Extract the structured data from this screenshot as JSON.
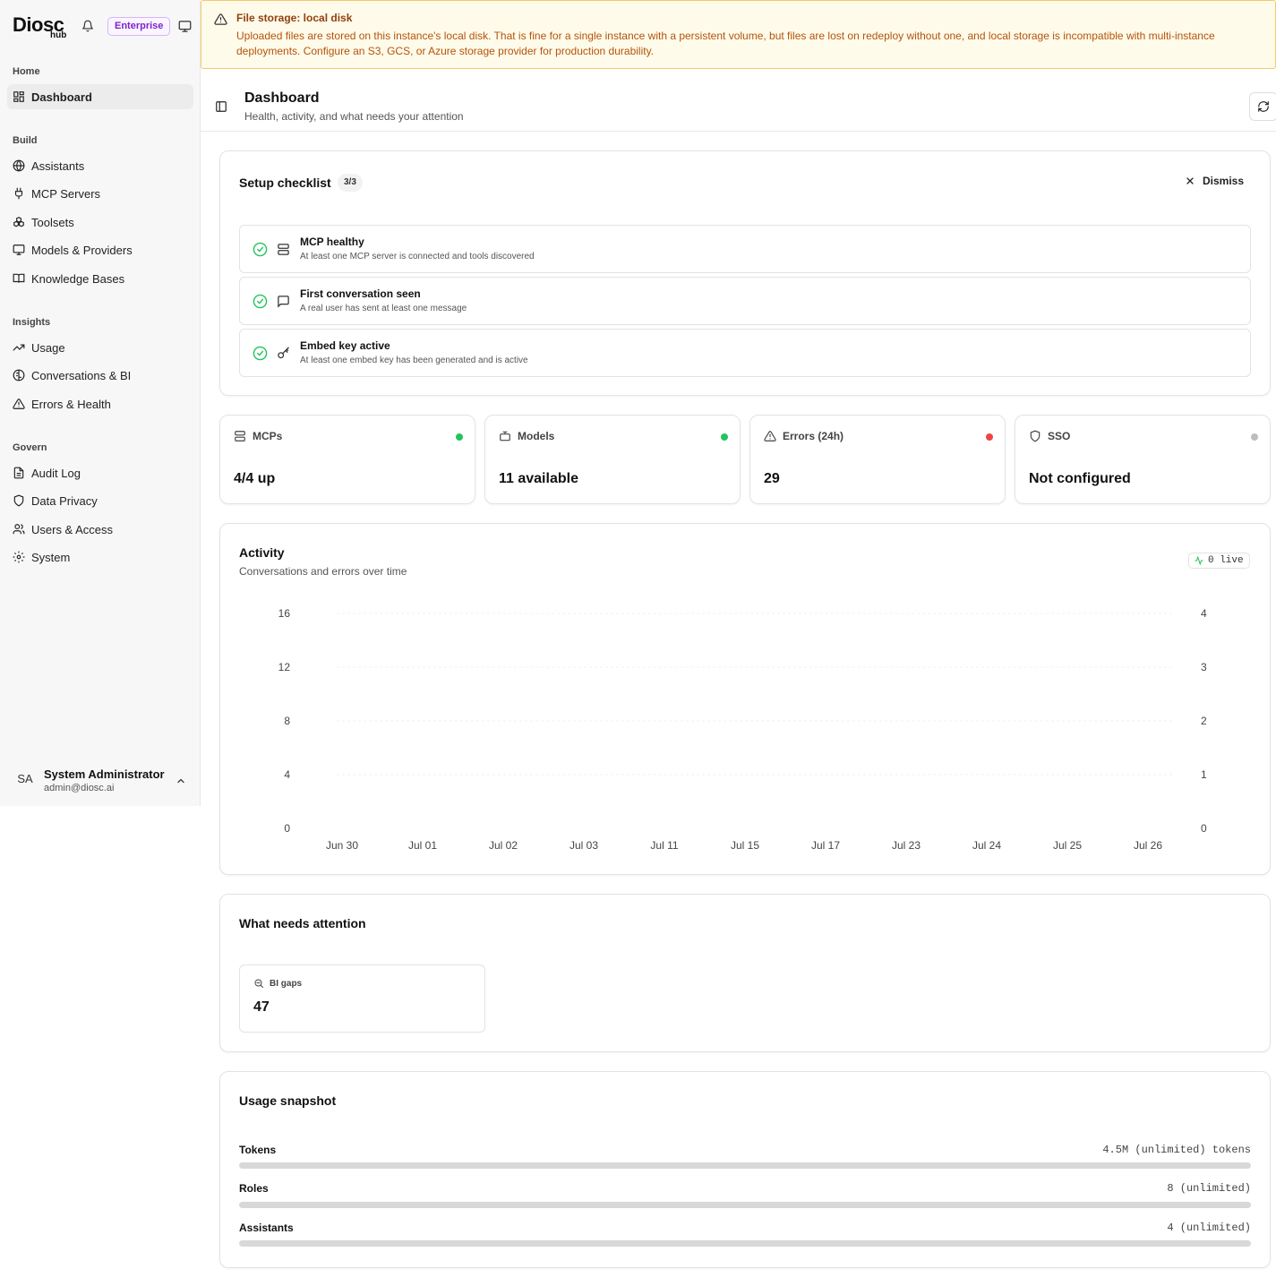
{
  "brand": {
    "name": "Diosc",
    "sub": "hub",
    "edition": "Enterprise"
  },
  "nav": {
    "sections": [
      {
        "label": "Home",
        "items": [
          {
            "label": "Dashboard",
            "icon": "dashboard-icon",
            "active": true
          }
        ]
      },
      {
        "label": "Build",
        "items": [
          {
            "label": "Assistants",
            "icon": "globe-icon"
          },
          {
            "label": "MCP Servers",
            "icon": "plug-icon"
          },
          {
            "label": "Toolsets",
            "icon": "boxes-icon"
          },
          {
            "label": "Models & Providers",
            "icon": "monitor-icon"
          },
          {
            "label": "Knowledge Bases",
            "icon": "book-icon"
          }
        ]
      },
      {
        "label": "Insights",
        "items": [
          {
            "label": "Usage",
            "icon": "trending-icon"
          },
          {
            "label": "Conversations & BI",
            "icon": "brain-icon"
          },
          {
            "label": "Errors & Health",
            "icon": "warning-icon"
          }
        ]
      },
      {
        "label": "Govern",
        "items": [
          {
            "label": "Audit Log",
            "icon": "file-text-icon"
          },
          {
            "label": "Data Privacy",
            "icon": "shield-icon"
          },
          {
            "label": "Users & Access",
            "icon": "users-icon"
          },
          {
            "label": "System",
            "icon": "gear-icon"
          }
        ]
      }
    ]
  },
  "user": {
    "initials": "SA",
    "name": "System Administrator",
    "email": "admin@diosc.ai"
  },
  "banner": {
    "title": "File storage: local disk",
    "text": "Uploaded files are stored on this instance's local disk. That is fine for a single instance with a persistent volume, but files are lost on redeploy without one, and local storage is incompatible with multi-instance deployments. Configure an S3, GCS, or Azure storage provider for production durability."
  },
  "header": {
    "title": "Dashboard",
    "subtitle": "Health, activity, and what needs your attention"
  },
  "checklist": {
    "title": "Setup checklist",
    "count": "3/3",
    "dismiss_label": "Dismiss",
    "items": [
      {
        "title": "MCP healthy",
        "desc": "At least one MCP server is connected and tools discovered",
        "icon": "server-icon"
      },
      {
        "title": "First conversation seen",
        "desc": "A real user has sent at least one message",
        "icon": "message-icon"
      },
      {
        "title": "Embed key active",
        "desc": "At least one embed key has been generated and is active",
        "icon": "key-icon"
      }
    ]
  },
  "stats": [
    {
      "label": "MCPs",
      "value": "4/4 up",
      "status_color": "#22c55e",
      "icon": "server-icon"
    },
    {
      "label": "Models",
      "value": "11 available",
      "status_color": "#22c55e",
      "icon": "bot-icon"
    },
    {
      "label": "Errors (24h)",
      "value": "29",
      "status_color": "#ef4444",
      "icon": "warning-icon"
    },
    {
      "label": "SSO",
      "value": "Not configured",
      "status_color": "#bdbdbd",
      "icon": "shield-icon"
    }
  ],
  "activity": {
    "title": "Activity",
    "subtitle": "Conversations and errors over time",
    "live_label": "0 live"
  },
  "chart_data": {
    "type": "line",
    "title": "Activity",
    "subtitle": "Conversations and errors over time",
    "x": [
      "Jun 30",
      "Jul 01",
      "Jul 02",
      "Jul 03",
      "Jul 11",
      "Jul 15",
      "Jul 17",
      "Jul 23",
      "Jul 24",
      "Jul 25",
      "Jul 26"
    ],
    "y_left_ticks": [
      0,
      4,
      8,
      12,
      16
    ],
    "y_right_ticks": [
      0,
      1,
      2,
      3,
      4
    ],
    "ylim_left": [
      0,
      16
    ],
    "ylim_right": [
      0,
      4
    ],
    "grid": true,
    "series": []
  },
  "attention": {
    "title": "What needs attention",
    "items": [
      {
        "label": "BI gaps",
        "value": "47",
        "icon": "search-icon"
      }
    ]
  },
  "usage": {
    "title": "Usage snapshot",
    "rows": [
      {
        "label": "Tokens",
        "value": "4.5M (unlimited) tokens",
        "fill": 0
      },
      {
        "label": "Roles",
        "value": "8 (unlimited)",
        "fill": 0
      },
      {
        "label": "Assistants",
        "value": "4 (unlimited)",
        "fill": 0
      }
    ]
  }
}
